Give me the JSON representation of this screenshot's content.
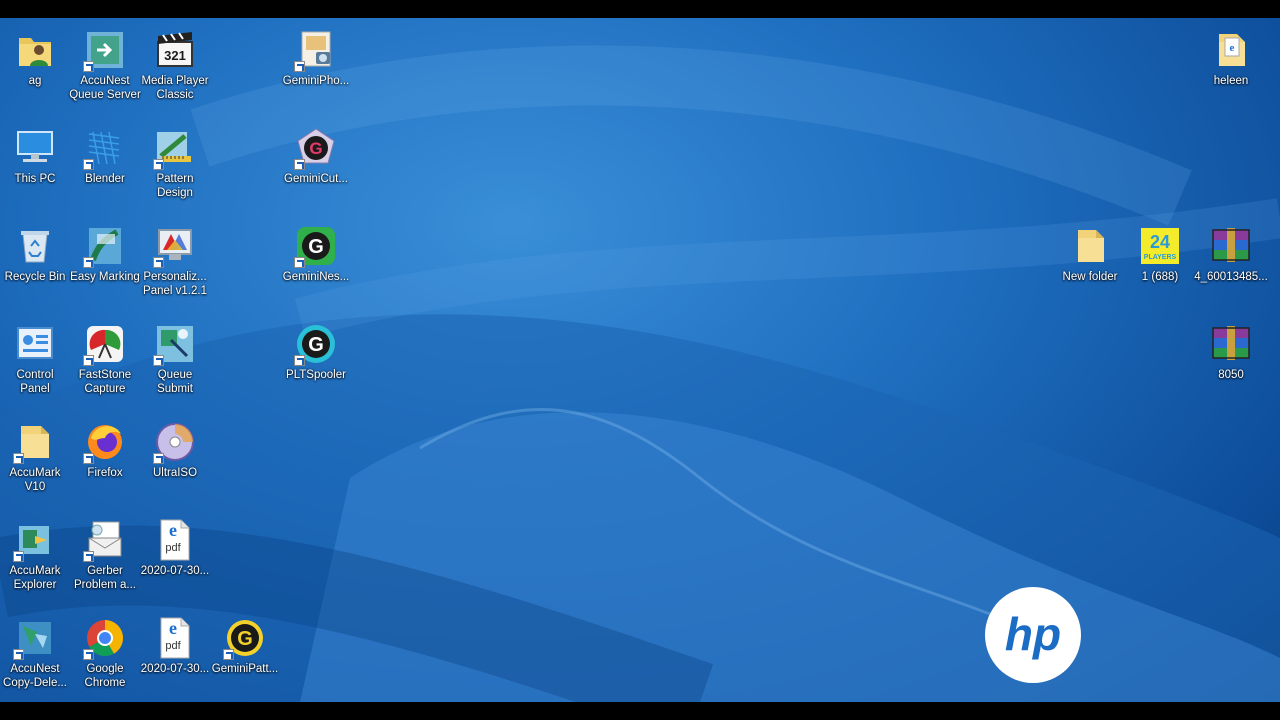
{
  "desktop": {
    "icons": {
      "ag": "ag",
      "accunest_queue": "AccuNest\nQueue Server",
      "mpc": "Media Player\nClassic",
      "geminipho": "GeminiPho...",
      "heleen": "heleen",
      "this_pc": "This PC",
      "blender": "Blender",
      "pattern_design": "Pattern\nDesign",
      "geminicut": "GeminiCut...",
      "recycle_bin": "Recycle Bin",
      "easy_marking": "Easy Marking",
      "personaliz": "Personaliz...\nPanel v1.2.1",
      "gemininest": "GeminiNes...",
      "new_folder": "New folder",
      "file_688": "1 (688)",
      "archive_4": "4_60013485...",
      "control_panel": "Control\nPanel",
      "faststone": "FastStone\nCapture",
      "queue_submit": "Queue\nSubmit",
      "pltspooler": "PLTSpooler",
      "archive_8050": "8050",
      "accumark_v10": "AccuMark\nV10",
      "firefox": "Firefox",
      "ultraiso": "UltraISO",
      "accumark_explorer": "AccuMark\nExplorer",
      "gerber_problem": "Gerber\nProblem a...",
      "pdf1": "2020-07-30...",
      "accunest_copy": "AccuNest\nCopy-Dele...",
      "chrome": "Google\nChrome",
      "pdf2": "2020-07-30...",
      "geminipatt": "GeminiPatt..."
    },
    "badge_24": "24",
    "badge_players": "PLAYERS",
    "pdf_text": "pdf",
    "hp_text": "hp",
    "mpc_digits": "321"
  }
}
